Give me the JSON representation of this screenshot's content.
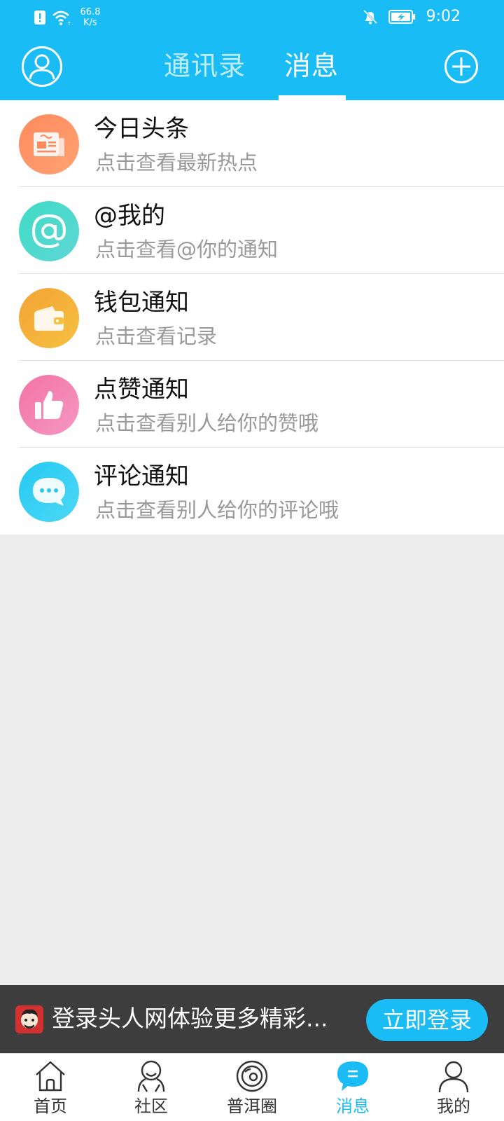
{
  "status_bar": {
    "network_speed": "66.8",
    "network_unit": "K/s",
    "time": "9:02",
    "icons": [
      "alert-icon",
      "wifi-icon",
      "bell-off-icon",
      "battery-charging-icon"
    ]
  },
  "header": {
    "tabs": [
      {
        "label": "通讯录",
        "active": false
      },
      {
        "label": "消息",
        "active": true
      }
    ],
    "icons": {
      "left": "user-avatar-icon",
      "right": "plus-circle-icon"
    }
  },
  "messages": [
    {
      "title": "今日头条",
      "subtitle": "点击查看最新热点",
      "icon": "newspaper-icon"
    },
    {
      "title": "@我的",
      "subtitle": "点击查看@你的通知",
      "icon": "at-sign-icon"
    },
    {
      "title": "钱包通知",
      "subtitle": "点击查看记录",
      "icon": "wallet-icon"
    },
    {
      "title": "点赞通知",
      "subtitle": "点击查看别人给你的赞哦",
      "icon": "thumbs-up-icon"
    },
    {
      "title": "评论通知",
      "subtitle": "点击查看别人给你的评论哦",
      "icon": "comment-bubble-icon"
    }
  ],
  "login_banner": {
    "text": "登录头人网体验更多精彩...",
    "button_label": "立即登录"
  },
  "bottom_nav": [
    {
      "label": "首页",
      "icon": "home-icon",
      "active": false
    },
    {
      "label": "社区",
      "icon": "community-icon",
      "active": false
    },
    {
      "label": "普洱圈",
      "icon": "circle-icon",
      "active": false
    },
    {
      "label": "消息",
      "icon": "message-icon",
      "active": true
    },
    {
      "label": "我的",
      "icon": "profile-icon",
      "active": false
    }
  ],
  "colors": {
    "primary": "#19bcf5",
    "background": "#ededed",
    "banner": "#3d3d3d",
    "subtitle_text": "#999999"
  }
}
